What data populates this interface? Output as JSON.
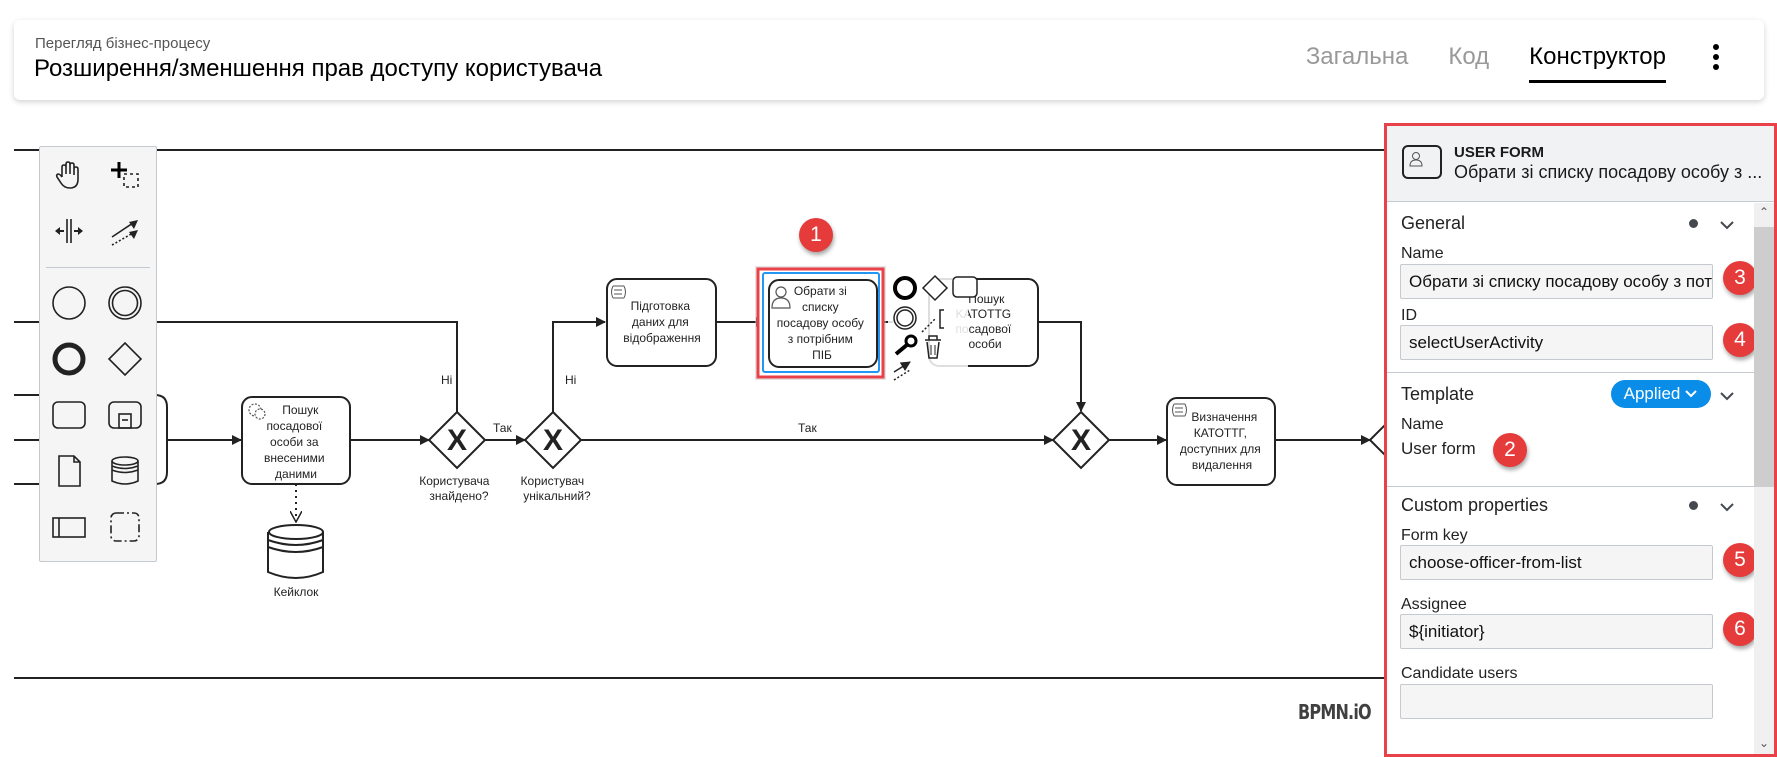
{
  "header": {
    "subtitle": "Перегляд бізнес-процесу",
    "title": "Розширення/зменшення прав доступу користувача",
    "tabs": [
      {
        "label": "Загальна",
        "active": false
      },
      {
        "label": "Код",
        "active": false
      },
      {
        "label": "Конструктор",
        "active": true
      }
    ],
    "more_icon": "kebab-menu-icon"
  },
  "palette": {
    "tools": [
      "hand-tool",
      "lasso-tool",
      "space-tool",
      "global-connect-tool"
    ],
    "shapes": [
      "start-event",
      "intermediate-event",
      "end-event",
      "gateway",
      "task",
      "subprocess",
      "data-object",
      "data-store",
      "pool",
      "group"
    ]
  },
  "diagram": {
    "tasks": {
      "search_officer": "Пошук посадової особи за внесеними даними",
      "prepare_data": "Підготовка даних для відображення",
      "select_officer": "Обрати зі списку посадову особу з потрібним ПІБ",
      "search_katottg": "Пошук КАТОТТG посадової особи",
      "define_katottg": "Визначення КАТОТТГ, доступних для видалення"
    },
    "gateways": {
      "user_found": "Користувача знайдено?",
      "user_unique": "Користувач унікальний?"
    },
    "flows": {
      "no": "Ні",
      "yes": "Так"
    },
    "data_store": "Кейклок",
    "logo": "BPMN.iO"
  },
  "badges": [
    "1",
    "2",
    "3",
    "4",
    "5",
    "6"
  ],
  "panel": {
    "element_type": "USER FORM",
    "element_name": "Обрати зі списку посадову особу з ...",
    "groups": {
      "general": {
        "title": "General",
        "name_label": "Name",
        "name_value": "Обрати зі списку посадову особу з потрібним ПІБ",
        "id_label": "ID",
        "id_value": "selectUserActivity"
      },
      "template": {
        "title": "Template",
        "status": "Applied",
        "name_label": "Name",
        "name_value": "User form"
      },
      "custom": {
        "title": "Custom properties",
        "form_key_label": "Form key",
        "form_key_value": "choose-officer-from-list",
        "assignee_label": "Assignee",
        "assignee_value": "${initiator}",
        "candidate_users_label": "Candidate users",
        "candidate_users_value": ""
      }
    }
  },
  "colors": {
    "accent_blue": "#0a8de8",
    "highlight_red": "#e8414a",
    "badge_red": "#e53b3b",
    "selection_blue": "#2196f3"
  }
}
